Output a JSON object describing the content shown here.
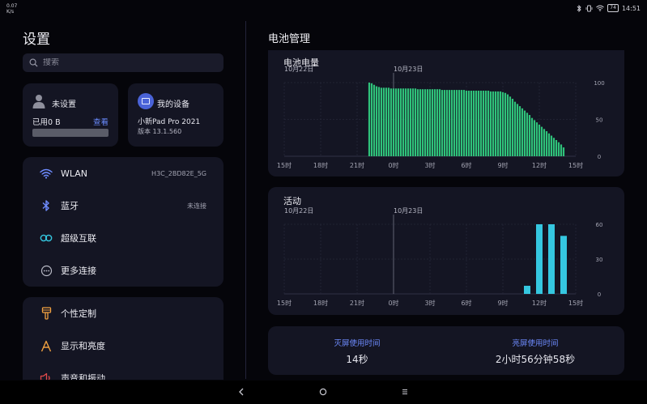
{
  "status": {
    "net_speed_value": "0.07",
    "net_speed_unit": "K/s",
    "battery_level": "74",
    "time": "14:51"
  },
  "left": {
    "title": "设置",
    "search_placeholder": "搜索",
    "account": {
      "name": "未设置",
      "used": "已用0 B",
      "view": "查看"
    },
    "device": {
      "label": "我的设备",
      "model": "小新Pad Pro 2021",
      "version": "版本 13.1.560"
    },
    "connections": [
      {
        "label": "WLAN",
        "value": "H3C_2BD82E_5G",
        "icon": "wifi-icon"
      },
      {
        "label": "蓝牙",
        "value": "未连接",
        "icon": "bluetooth-icon"
      },
      {
        "label": "超级互联",
        "value": "",
        "icon": "super-link-icon"
      },
      {
        "label": "更多连接",
        "value": "",
        "icon": "more-connections-icon"
      }
    ],
    "personal": [
      {
        "label": "个性定制",
        "icon": "brush-icon"
      },
      {
        "label": "显示和亮度",
        "icon": "display-icon"
      },
      {
        "label": "声音和振动",
        "icon": "sound-icon"
      }
    ]
  },
  "right": {
    "title": "电池管理",
    "summary": {
      "screen_off_label": "灭屏使用时间",
      "screen_off_value": "14秒",
      "screen_on_label": "亮屏使用时间",
      "screen_on_value": "2小时56分钟58秒"
    }
  },
  "colors": {
    "battery_bar": "#2fc27a",
    "activity_bar": "#35c7e0",
    "accent": "#6e8cff"
  },
  "chart_data": [
    {
      "type": "bar",
      "title": "电池电量",
      "date_labels": [
        "10月22日",
        "10月23日"
      ],
      "x_tick_labels": [
        "15时",
        "18时",
        "21时",
        "0时",
        "3时",
        "6时",
        "9时",
        "12时",
        "15时"
      ],
      "x_hours": [
        15,
        18,
        21,
        24,
        27,
        30,
        33,
        36,
        39
      ],
      "y_tick_labels": [
        "100",
        "50",
        "0"
      ],
      "ylim": [
        0,
        100
      ],
      "xlim": [
        15,
        39
      ],
      "bars": {
        "x_hours": [
          22.0,
          22.2,
          22.4,
          22.6,
          22.8,
          23.0,
          23.2,
          23.4,
          23.6,
          23.8,
          24.0,
          24.2,
          24.4,
          24.6,
          24.8,
          25.0,
          25.2,
          25.4,
          25.6,
          25.8,
          26.0,
          26.2,
          26.4,
          26.6,
          26.8,
          27.0,
          27.2,
          27.4,
          27.6,
          27.8,
          28.0,
          28.2,
          28.4,
          28.6,
          28.8,
          29.0,
          29.2,
          29.4,
          29.6,
          29.8,
          30.0,
          30.2,
          30.4,
          30.6,
          30.8,
          31.0,
          31.2,
          31.4,
          31.6,
          31.8,
          32.0,
          32.2,
          32.4,
          32.6,
          32.8,
          33.0,
          33.2,
          33.4,
          33.6,
          33.8,
          34.0,
          34.2,
          34.4,
          34.6,
          34.8,
          35.0,
          35.2,
          35.4,
          35.6,
          35.8,
          36.0,
          36.2,
          36.4,
          36.6,
          36.8,
          37.0,
          37.2,
          37.4,
          37.6,
          37.8,
          38.0
        ],
        "values": [
          100,
          99,
          97,
          95,
          94,
          93,
          93,
          93,
          93,
          92,
          92,
          92,
          92,
          92,
          92,
          92,
          92,
          92,
          92,
          92,
          91,
          91,
          91,
          91,
          91,
          91,
          91,
          91,
          91,
          91,
          90,
          90,
          90,
          90,
          90,
          90,
          90,
          90,
          90,
          90,
          89,
          89,
          89,
          89,
          89,
          89,
          89,
          89,
          89,
          89,
          88,
          88,
          88,
          88,
          88,
          87,
          86,
          84,
          81,
          78,
          74,
          71,
          68,
          65,
          62,
          59,
          56,
          52,
          49,
          46,
          43,
          40,
          37,
          34,
          31,
          28,
          25,
          22,
          19,
          16,
          12
        ]
      }
    },
    {
      "type": "bar",
      "title": "活动",
      "date_labels": [
        "10月22日",
        "10月23日"
      ],
      "x_tick_labels": [
        "15时",
        "18时",
        "21时",
        "0时",
        "3时",
        "6时",
        "9时",
        "12时",
        "15时"
      ],
      "x_hours": [
        15,
        18,
        21,
        24,
        27,
        30,
        33,
        36,
        39
      ],
      "y_tick_labels": [
        "60",
        "30",
        "0"
      ],
      "ylim": [
        0,
        60
      ],
      "xlim": [
        15,
        39
      ],
      "bars": {
        "x_hours": [
          35.0,
          36.0,
          37.0,
          38.0
        ],
        "values": [
          7,
          60,
          60,
          50
        ]
      }
    }
  ]
}
